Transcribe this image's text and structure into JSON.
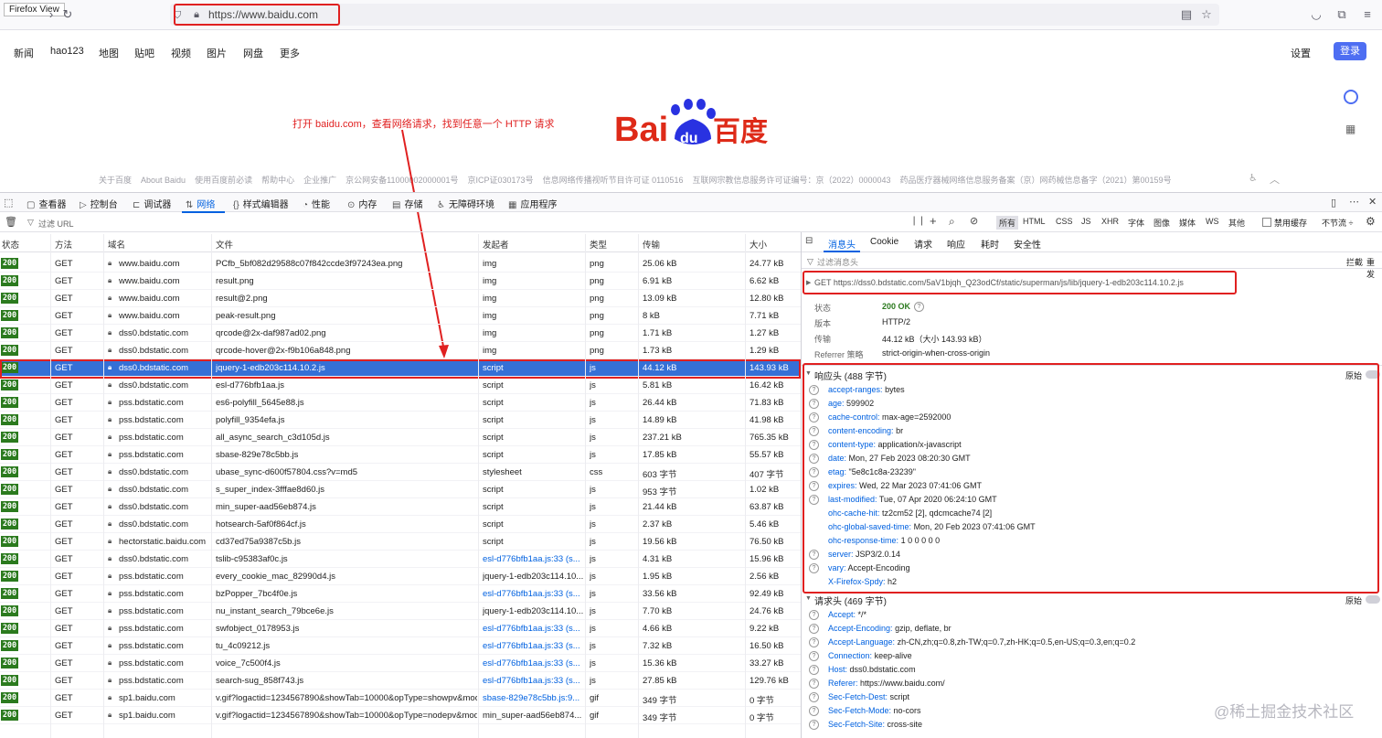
{
  "browser": {
    "firefox_view": "Firefox View",
    "url": "https://www.baidu.com"
  },
  "baidu": {
    "nav": [
      "新闻",
      "hao123",
      "地图",
      "贴吧",
      "视频",
      "图片",
      "网盘",
      "更多"
    ],
    "settings": "设置",
    "login": "登录",
    "logo_text": "Bai du 百度",
    "footer": [
      "关于百度",
      "About Baidu",
      "使用百度前必读",
      "帮助中心",
      "企业推广",
      "京公网安备11000002000001号",
      "京ICP证030173号",
      "信息网络传播视听节目许可证 0110516",
      "互联网宗教信息服务许可证编号：京（2022）0000043",
      "药品医疗器械网络信息服务备案（京）网药械信息备字（2021）第00159号"
    ]
  },
  "annotation": "打开 baidu.com，查看网络请求，找到任意一个 HTTP 请求",
  "devtools": {
    "tabs": [
      "查看器",
      "控制台",
      "调试器",
      "网络",
      "样式编辑器",
      "性能",
      "内存",
      "存储",
      "无障碍环境",
      "应用程序"
    ],
    "active_tab": "网络",
    "filter_placeholder": "过滤 URL",
    "type_filters": [
      "所有",
      "HTML",
      "CSS",
      "JS",
      "XHR",
      "字体",
      "图像",
      "媒体",
      "WS",
      "其他"
    ],
    "disable_cache": "禁用缓存",
    "throttle": "不节流 ÷",
    "columns": [
      "状态",
      "方法",
      "域名",
      "文件",
      "发起者",
      "类型",
      "传输",
      "大小"
    ],
    "rows": [
      {
        "status": "200",
        "method": "GET",
        "domain": "www.baidu.com",
        "file": "PCfb_5bf082d29588c07f842ccde3f97243ea.png",
        "initiator": "img",
        "type": "png",
        "transfer": "25.06 kB",
        "size": "24.77 kB"
      },
      {
        "status": "200",
        "method": "GET",
        "domain": "www.baidu.com",
        "file": "result.png",
        "initiator": "img",
        "type": "png",
        "transfer": "6.91 kB",
        "size": "6.62 kB"
      },
      {
        "status": "200",
        "method": "GET",
        "domain": "www.baidu.com",
        "file": "result@2.png",
        "initiator": "img",
        "type": "png",
        "transfer": "13.09 kB",
        "size": "12.80 kB"
      },
      {
        "status": "200",
        "method": "GET",
        "domain": "www.baidu.com",
        "file": "peak-result.png",
        "initiator": "img",
        "type": "png",
        "transfer": "8 kB",
        "size": "7.71 kB"
      },
      {
        "status": "200",
        "method": "GET",
        "domain": "dss0.bdstatic.com",
        "file": "qrcode@2x-daf987ad02.png",
        "initiator": "img",
        "type": "png",
        "transfer": "1.71 kB",
        "size": "1.27 kB"
      },
      {
        "status": "200",
        "method": "GET",
        "domain": "dss0.bdstatic.com",
        "file": "qrcode-hover@2x-f9b106a848.png",
        "initiator": "img",
        "type": "png",
        "transfer": "1.73 kB",
        "size": "1.29 kB"
      },
      {
        "status": "200",
        "method": "GET",
        "domain": "dss0.bdstatic.com",
        "file": "jquery-1-edb203c114.10.2.js",
        "initiator": "script",
        "type": "js",
        "transfer": "44.12 kB",
        "size": "143.93 kB"
      },
      {
        "status": "200",
        "method": "GET",
        "domain": "dss0.bdstatic.com",
        "file": "esl-d776bfb1aa.js",
        "initiator": "script",
        "type": "js",
        "transfer": "5.81 kB",
        "size": "16.42 kB"
      },
      {
        "status": "200",
        "method": "GET",
        "domain": "pss.bdstatic.com",
        "file": "es6-polyfill_5645e88.js",
        "initiator": "script",
        "type": "js",
        "transfer": "26.44 kB",
        "size": "71.83 kB"
      },
      {
        "status": "200",
        "method": "GET",
        "domain": "pss.bdstatic.com",
        "file": "polyfill_9354efa.js",
        "initiator": "script",
        "type": "js",
        "transfer": "14.89 kB",
        "size": "41.98 kB"
      },
      {
        "status": "200",
        "method": "GET",
        "domain": "pss.bdstatic.com",
        "file": "all_async_search_c3d105d.js",
        "initiator": "script",
        "type": "js",
        "transfer": "237.21 kB",
        "size": "765.35 kB"
      },
      {
        "status": "200",
        "method": "GET",
        "domain": "pss.bdstatic.com",
        "file": "sbase-829e78c5bb.js",
        "initiator": "script",
        "type": "js",
        "transfer": "17.85 kB",
        "size": "55.57 kB"
      },
      {
        "status": "200",
        "method": "GET",
        "domain": "dss0.bdstatic.com",
        "file": "ubase_sync-d600f57804.css?v=md5",
        "initiator": "stylesheet",
        "type": "css",
        "transfer": "603 字节",
        "size": "407 字节"
      },
      {
        "status": "200",
        "method": "GET",
        "domain": "dss0.bdstatic.com",
        "file": "s_super_index-3fffae8d60.js",
        "initiator": "script",
        "type": "js",
        "transfer": "953 字节",
        "size": "1.02 kB"
      },
      {
        "status": "200",
        "method": "GET",
        "domain": "dss0.bdstatic.com",
        "file": "min_super-aad56eb874.js",
        "initiator": "script",
        "type": "js",
        "transfer": "21.44 kB",
        "size": "63.87 kB"
      },
      {
        "status": "200",
        "method": "GET",
        "domain": "dss0.bdstatic.com",
        "file": "hotsearch-5af0f864cf.js",
        "initiator": "script",
        "type": "js",
        "transfer": "2.37 kB",
        "size": "5.46 kB"
      },
      {
        "status": "200",
        "method": "GET",
        "domain": "hectorstatic.baidu.com",
        "file": "cd37ed75a9387c5b.js",
        "initiator": "script",
        "type": "js",
        "transfer": "19.56 kB",
        "size": "76.50 kB"
      },
      {
        "status": "200",
        "method": "GET",
        "domain": "dss0.bdstatic.com",
        "file": "tslib-c95383af0c.js",
        "initiator": "esl-d776bfb1aa.js:33 (s...",
        "type": "js",
        "transfer": "4.31 kB",
        "size": "15.96 kB"
      },
      {
        "status": "200",
        "method": "GET",
        "domain": "pss.bdstatic.com",
        "file": "every_cookie_mac_82990d4.js",
        "initiator": "jquery-1-edb203c114.10...",
        "type": "js",
        "transfer": "1.95 kB",
        "size": "2.56 kB"
      },
      {
        "status": "200",
        "method": "GET",
        "domain": "pss.bdstatic.com",
        "file": "bzPopper_7bc4f0e.js",
        "initiator": "esl-d776bfb1aa.js:33 (s...",
        "type": "js",
        "transfer": "33.56 kB",
        "size": "92.49 kB"
      },
      {
        "status": "200",
        "method": "GET",
        "domain": "pss.bdstatic.com",
        "file": "nu_instant_search_79bce6e.js",
        "initiator": "jquery-1-edb203c114.10...",
        "type": "js",
        "transfer": "7.70 kB",
        "size": "24.76 kB"
      },
      {
        "status": "200",
        "method": "GET",
        "domain": "pss.bdstatic.com",
        "file": "swfobject_0178953.js",
        "initiator": "esl-d776bfb1aa.js:33 (s...",
        "type": "js",
        "transfer": "4.66 kB",
        "size": "9.22 kB"
      },
      {
        "status": "200",
        "method": "GET",
        "domain": "pss.bdstatic.com",
        "file": "tu_4c09212.js",
        "initiator": "esl-d776bfb1aa.js:33 (s...",
        "type": "js",
        "transfer": "7.32 kB",
        "size": "16.50 kB"
      },
      {
        "status": "200",
        "method": "GET",
        "domain": "pss.bdstatic.com",
        "file": "voice_7c500f4.js",
        "initiator": "esl-d776bfb1aa.js:33 (s...",
        "type": "js",
        "transfer": "15.36 kB",
        "size": "33.27 kB"
      },
      {
        "status": "200",
        "method": "GET",
        "domain": "pss.bdstatic.com",
        "file": "search-sug_858f743.js",
        "initiator": "esl-d776bfb1aa.js:33 (s...",
        "type": "js",
        "transfer": "27.85 kB",
        "size": "129.76 kB"
      },
      {
        "status": "200",
        "method": "GET",
        "domain": "sp1.baidu.com",
        "file": "v.gif?logactid=1234567890&showTab=10000&opType=showpv&mod=",
        "initiator": "sbase-829e78c5bb.js:9...",
        "type": "gif",
        "transfer": "349 字节",
        "size": "0 字节"
      },
      {
        "status": "200",
        "method": "GET",
        "domain": "sp1.baidu.com",
        "file": "v.gif?logactid=1234567890&showTab=10000&opType=nodepv&mod=",
        "initiator": "min_super-aad56eb874...",
        "type": "gif",
        "transfer": "349 字节",
        "size": "0 字节"
      }
    ],
    "detail": {
      "tabs": [
        "消息头",
        "Cookie",
        "请求",
        "响应",
        "耗时",
        "安全性"
      ],
      "filter_placeholder": "过滤消息头",
      "block": "拦截",
      "resend": "重发",
      "request_line": "GET  https://dss0.bdstatic.com/5aV1bjqh_Q23odCf/static/superman/js/lib/jquery-1-edb203c114.10.2.js",
      "summary": [
        {
          "label": "状态",
          "value": "200 OK"
        },
        {
          "label": "版本",
          "value": "HTTP/2"
        },
        {
          "label": "传输",
          "value": "44.12 kB（大小 143.93 kB）"
        },
        {
          "label": "Referrer 策略",
          "value": "strict-origin-when-cross-origin"
        }
      ],
      "response_title": "响应头 (488 字节)",
      "raw": "原始",
      "response_headers": [
        {
          "k": "accept-ranges:",
          "v": "bytes",
          "q": true
        },
        {
          "k": "age:",
          "v": "599902",
          "q": true
        },
        {
          "k": "cache-control:",
          "v": "max-age=2592000",
          "q": true
        },
        {
          "k": "content-encoding:",
          "v": "br",
          "q": true
        },
        {
          "k": "content-type:",
          "v": "application/x-javascript",
          "q": true
        },
        {
          "k": "date:",
          "v": "Mon, 27 Feb 2023 08:20:30 GMT",
          "q": true
        },
        {
          "k": "etag:",
          "v": "\"5e8c1c8a-23239\"",
          "q": true
        },
        {
          "k": "expires:",
          "v": "Wed, 22 Mar 2023 07:41:06 GMT",
          "q": true
        },
        {
          "k": "last-modified:",
          "v": "Tue, 07 Apr 2020 06:24:10 GMT",
          "q": true
        },
        {
          "k": "ohc-cache-hit:",
          "v": "tz2cm52 [2], qdcmcache74 [2]",
          "q": false
        },
        {
          "k": "ohc-global-saved-time:",
          "v": "Mon, 20 Feb 2023 07:41:06 GMT",
          "q": false
        },
        {
          "k": "ohc-response-time:",
          "v": "1 0 0 0 0 0",
          "q": false
        },
        {
          "k": "server:",
          "v": "JSP3/2.0.14",
          "q": true
        },
        {
          "k": "vary:",
          "v": "Accept-Encoding",
          "q": true
        },
        {
          "k": "X-Firefox-Spdy:",
          "v": "h2",
          "q": false
        }
      ],
      "request_title": "请求头 (469 字节)",
      "request_headers": [
        {
          "k": "Accept:",
          "v": "*/*"
        },
        {
          "k": "Accept-Encoding:",
          "v": "gzip, deflate, br"
        },
        {
          "k": "Accept-Language:",
          "v": "zh-CN,zh;q=0.8,zh-TW;q=0.7,zh-HK;q=0.5,en-US;q=0.3,en;q=0.2"
        },
        {
          "k": "Connection:",
          "v": "keep-alive"
        },
        {
          "k": "Host:",
          "v": "dss0.bdstatic.com"
        },
        {
          "k": "Referer:",
          "v": "https://www.baidu.com/"
        },
        {
          "k": "Sec-Fetch-Dest:",
          "v": "script"
        },
        {
          "k": "Sec-Fetch-Mode:",
          "v": "no-cors"
        },
        {
          "k": "Sec-Fetch-Site:",
          "v": "cross-site"
        }
      ]
    }
  },
  "watermark": "@稀土掘金技术社区",
  "colors": {
    "status_ok": "#2b7a1e",
    "selected_row": "#3570d6",
    "accent": "#0061e0",
    "annotation": "#e02020",
    "baidu_red": "#de2a18",
    "baidu_blue": "#2932e1"
  }
}
